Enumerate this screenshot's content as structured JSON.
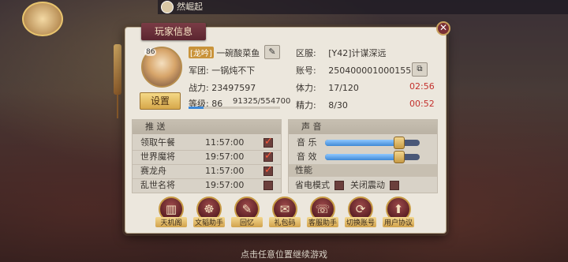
{
  "background": {
    "topbar_text": "然崛起",
    "bottom_hint": "点击任意位置继续游戏"
  },
  "dialog": {
    "title": "玩家信息",
    "close_symbol": "✕",
    "player": {
      "avatar_level": "86",
      "name_tag": "[龙吟]",
      "name": "一碗酸菜鱼",
      "legion": "军团: 一锅炖不下",
      "power_label": "战力:",
      "power_value": "23497597",
      "level_label": "等级:",
      "level_value": "86",
      "exp_text": "91325/554700",
      "exp_fraction": 0.165,
      "settings_label": "设置",
      "edit_icon": "✎"
    },
    "account": {
      "server_label": "区服:",
      "server_value": "[Y42]计谋深远",
      "account_label": "账号:",
      "account_value": "250400001000155",
      "copy_icon": "⧉",
      "stamina_label": "体力:",
      "stamina_value": "17/120",
      "stamina_timer": "02:56",
      "energy_label": "精力:",
      "energy_value": "8/30",
      "energy_timer": "00:52"
    },
    "push": {
      "header": "推 送",
      "items": [
        {
          "name": "领取午餐",
          "time": "11:57:00",
          "checked": true
        },
        {
          "name": "世界魔将",
          "time": "19:57:00",
          "checked": true
        },
        {
          "name": "赛龙舟",
          "time": "11:57:00",
          "checked": true
        },
        {
          "name": "乱世名将",
          "time": "19:57:00",
          "checked": false
        }
      ]
    },
    "sound": {
      "header": "声 音",
      "music_label": "音 乐",
      "music_level": 0.78,
      "sfx_label": "音 效",
      "sfx_level": 0.78,
      "perf_header": "性能",
      "power_save_label": "省电模式",
      "power_save_checked": false,
      "vibration_label": "关闭震动",
      "vibration_checked": false
    },
    "actions": [
      {
        "label": "天机阁",
        "icon": "▥"
      },
      {
        "label": "文韬助手",
        "icon": "☸"
      },
      {
        "label": "回忆",
        "icon": "✎"
      },
      {
        "label": "礼包码",
        "icon": "✉"
      },
      {
        "label": "客服助手",
        "icon": "☏"
      },
      {
        "label": "切换账号",
        "icon": "⟳"
      },
      {
        "label": "用户协议",
        "icon": "⬆"
      }
    ]
  }
}
